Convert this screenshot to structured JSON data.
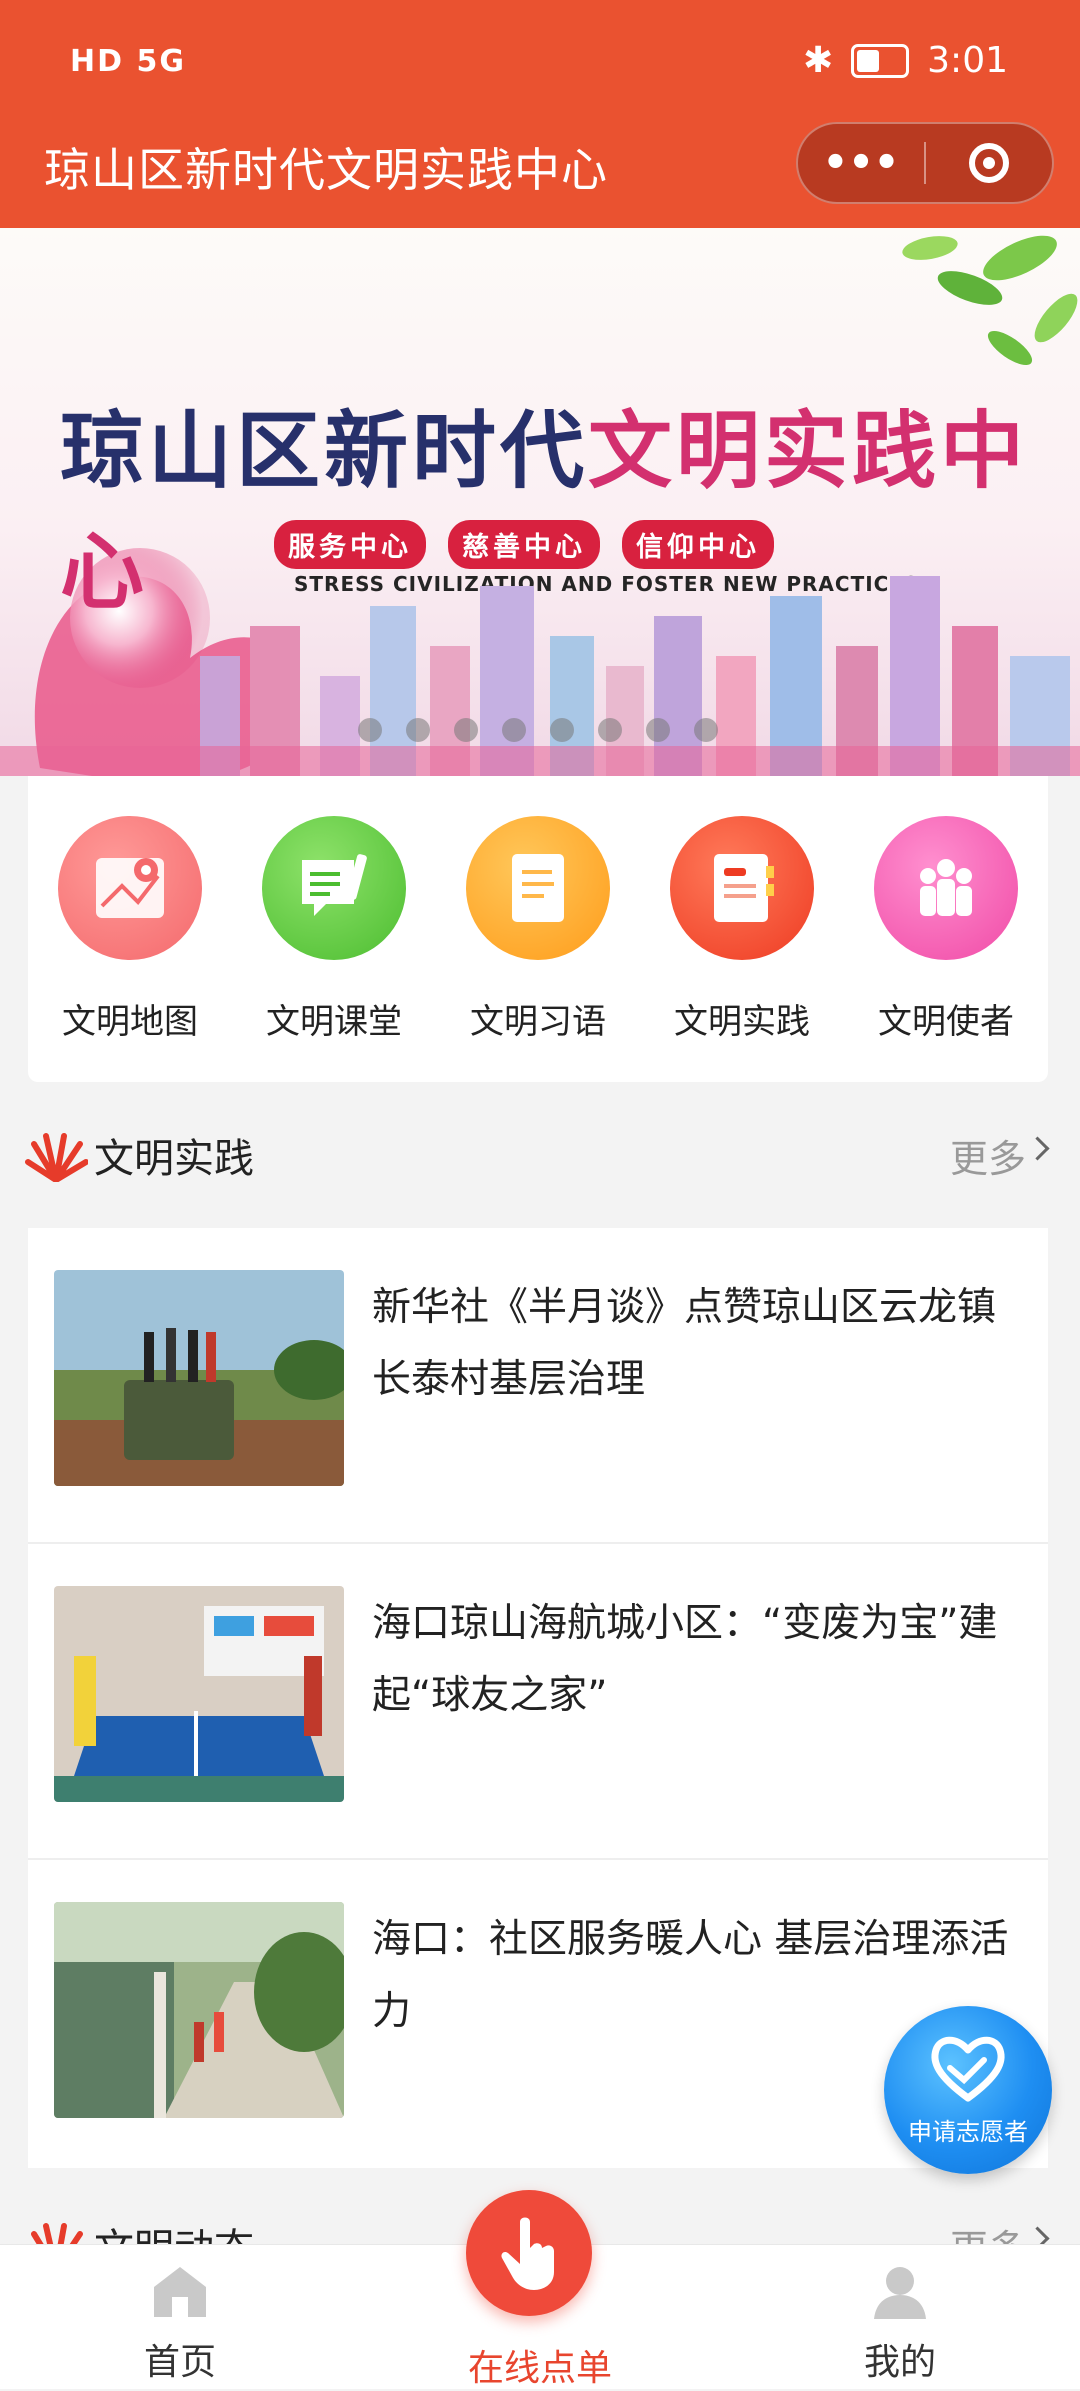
{
  "status_bar": {
    "left": "HD 5G",
    "time": "3:01",
    "bluetooth": "✱"
  },
  "header": {
    "title": "琼山区新时代文明实践中心",
    "menu_label": "•••"
  },
  "banner": {
    "title_part1": "琼山区新时代",
    "title_part2": "文明实践中心",
    "tags": [
      "服务中心",
      "慈善中心",
      "信仰中心"
    ],
    "slogan": "STRESS CIVILIZATION AND FOSTER NEW PRACTICES",
    "page_count": 8
  },
  "grid": [
    {
      "label": "文明地图",
      "icon": "map-icon",
      "color": "#f4696c"
    },
    {
      "label": "文明课堂",
      "icon": "classroom-icon",
      "color": "#5cc83c"
    },
    {
      "label": "文明习语",
      "icon": "document-icon",
      "color": "#ffaa22"
    },
    {
      "label": "文明实践",
      "icon": "notebook-icon",
      "color": "#f2452e"
    },
    {
      "label": "文明使者",
      "icon": "people-icon",
      "color": "#f550a9"
    }
  ],
  "practice": {
    "title": "文明实践",
    "more": "更多",
    "articles": [
      {
        "title": "新华社《半月谈》点赞琼山区云龙镇长泰村基层治理"
      },
      {
        "title": "海口琼山海航城小区：“变废为宝”建起“球友之家”"
      },
      {
        "title": "海口：社区服务暖人心 基层治理添活力"
      }
    ]
  },
  "news": {
    "title": "文明动态",
    "more": "更多"
  },
  "volunteer": {
    "label": "申请志愿者"
  },
  "tabbar": {
    "home": "首页",
    "order": "在线点单",
    "mine": "我的"
  }
}
